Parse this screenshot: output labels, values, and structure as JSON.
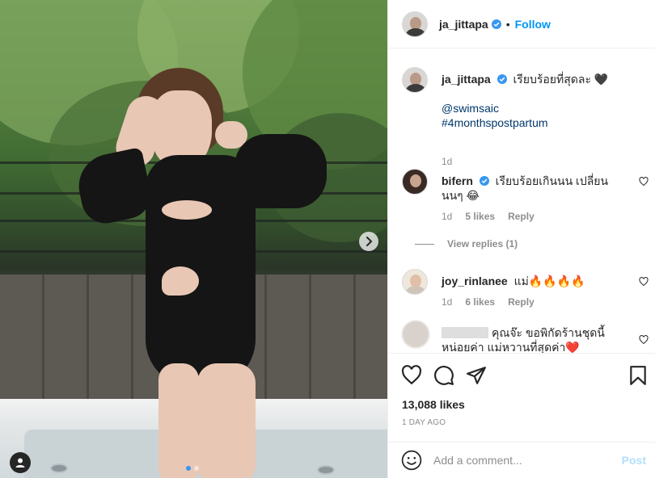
{
  "post": {
    "author": "ja_jittapa",
    "follow_label": "Follow",
    "separator": "•",
    "carousel": {
      "total_slides": 2,
      "active_slide": 1
    }
  },
  "caption": {
    "username": "ja_jittapa",
    "text": "เรียบร้อยที่สุดละ 🖤",
    "mention": "@swimsaic",
    "hashtag": "#4monthspostpartum",
    "age": "1d"
  },
  "comments": [
    {
      "username": "bifern",
      "verified": true,
      "text": "เรียบร้อยเกินนน เปลี่ยนนนๆ 😂",
      "age": "1d",
      "likes": "5 likes",
      "reply_label": "Reply",
      "view_replies": "View replies (1)"
    },
    {
      "username": "joy_rinlanee",
      "verified": false,
      "text": "แม่🔥🔥🔥🔥",
      "age": "1d",
      "likes": "6 likes",
      "reply_label": "Reply"
    },
    {
      "username": "",
      "verified": false,
      "text": "คุณจ๊ะ ขอพิกัดร้านชุดนี้หน่อยค่า แม่หวานที่สุดค่า❤️"
    }
  ],
  "actions": {
    "likes": "13,088 likes",
    "date": "1 DAY AGO"
  },
  "add_comment": {
    "placeholder": "Add a comment...",
    "post_label": "Post"
  },
  "colors": {
    "link_blue": "#0095f6",
    "post_disabled": "#b2dffc",
    "muted": "#8e8e8e"
  },
  "icons": [
    "user-tag-icon",
    "chevron-right-icon",
    "verified-badge-icon",
    "heart-icon",
    "comment-icon",
    "share-icon",
    "bookmark-icon",
    "emoji-icon"
  ]
}
